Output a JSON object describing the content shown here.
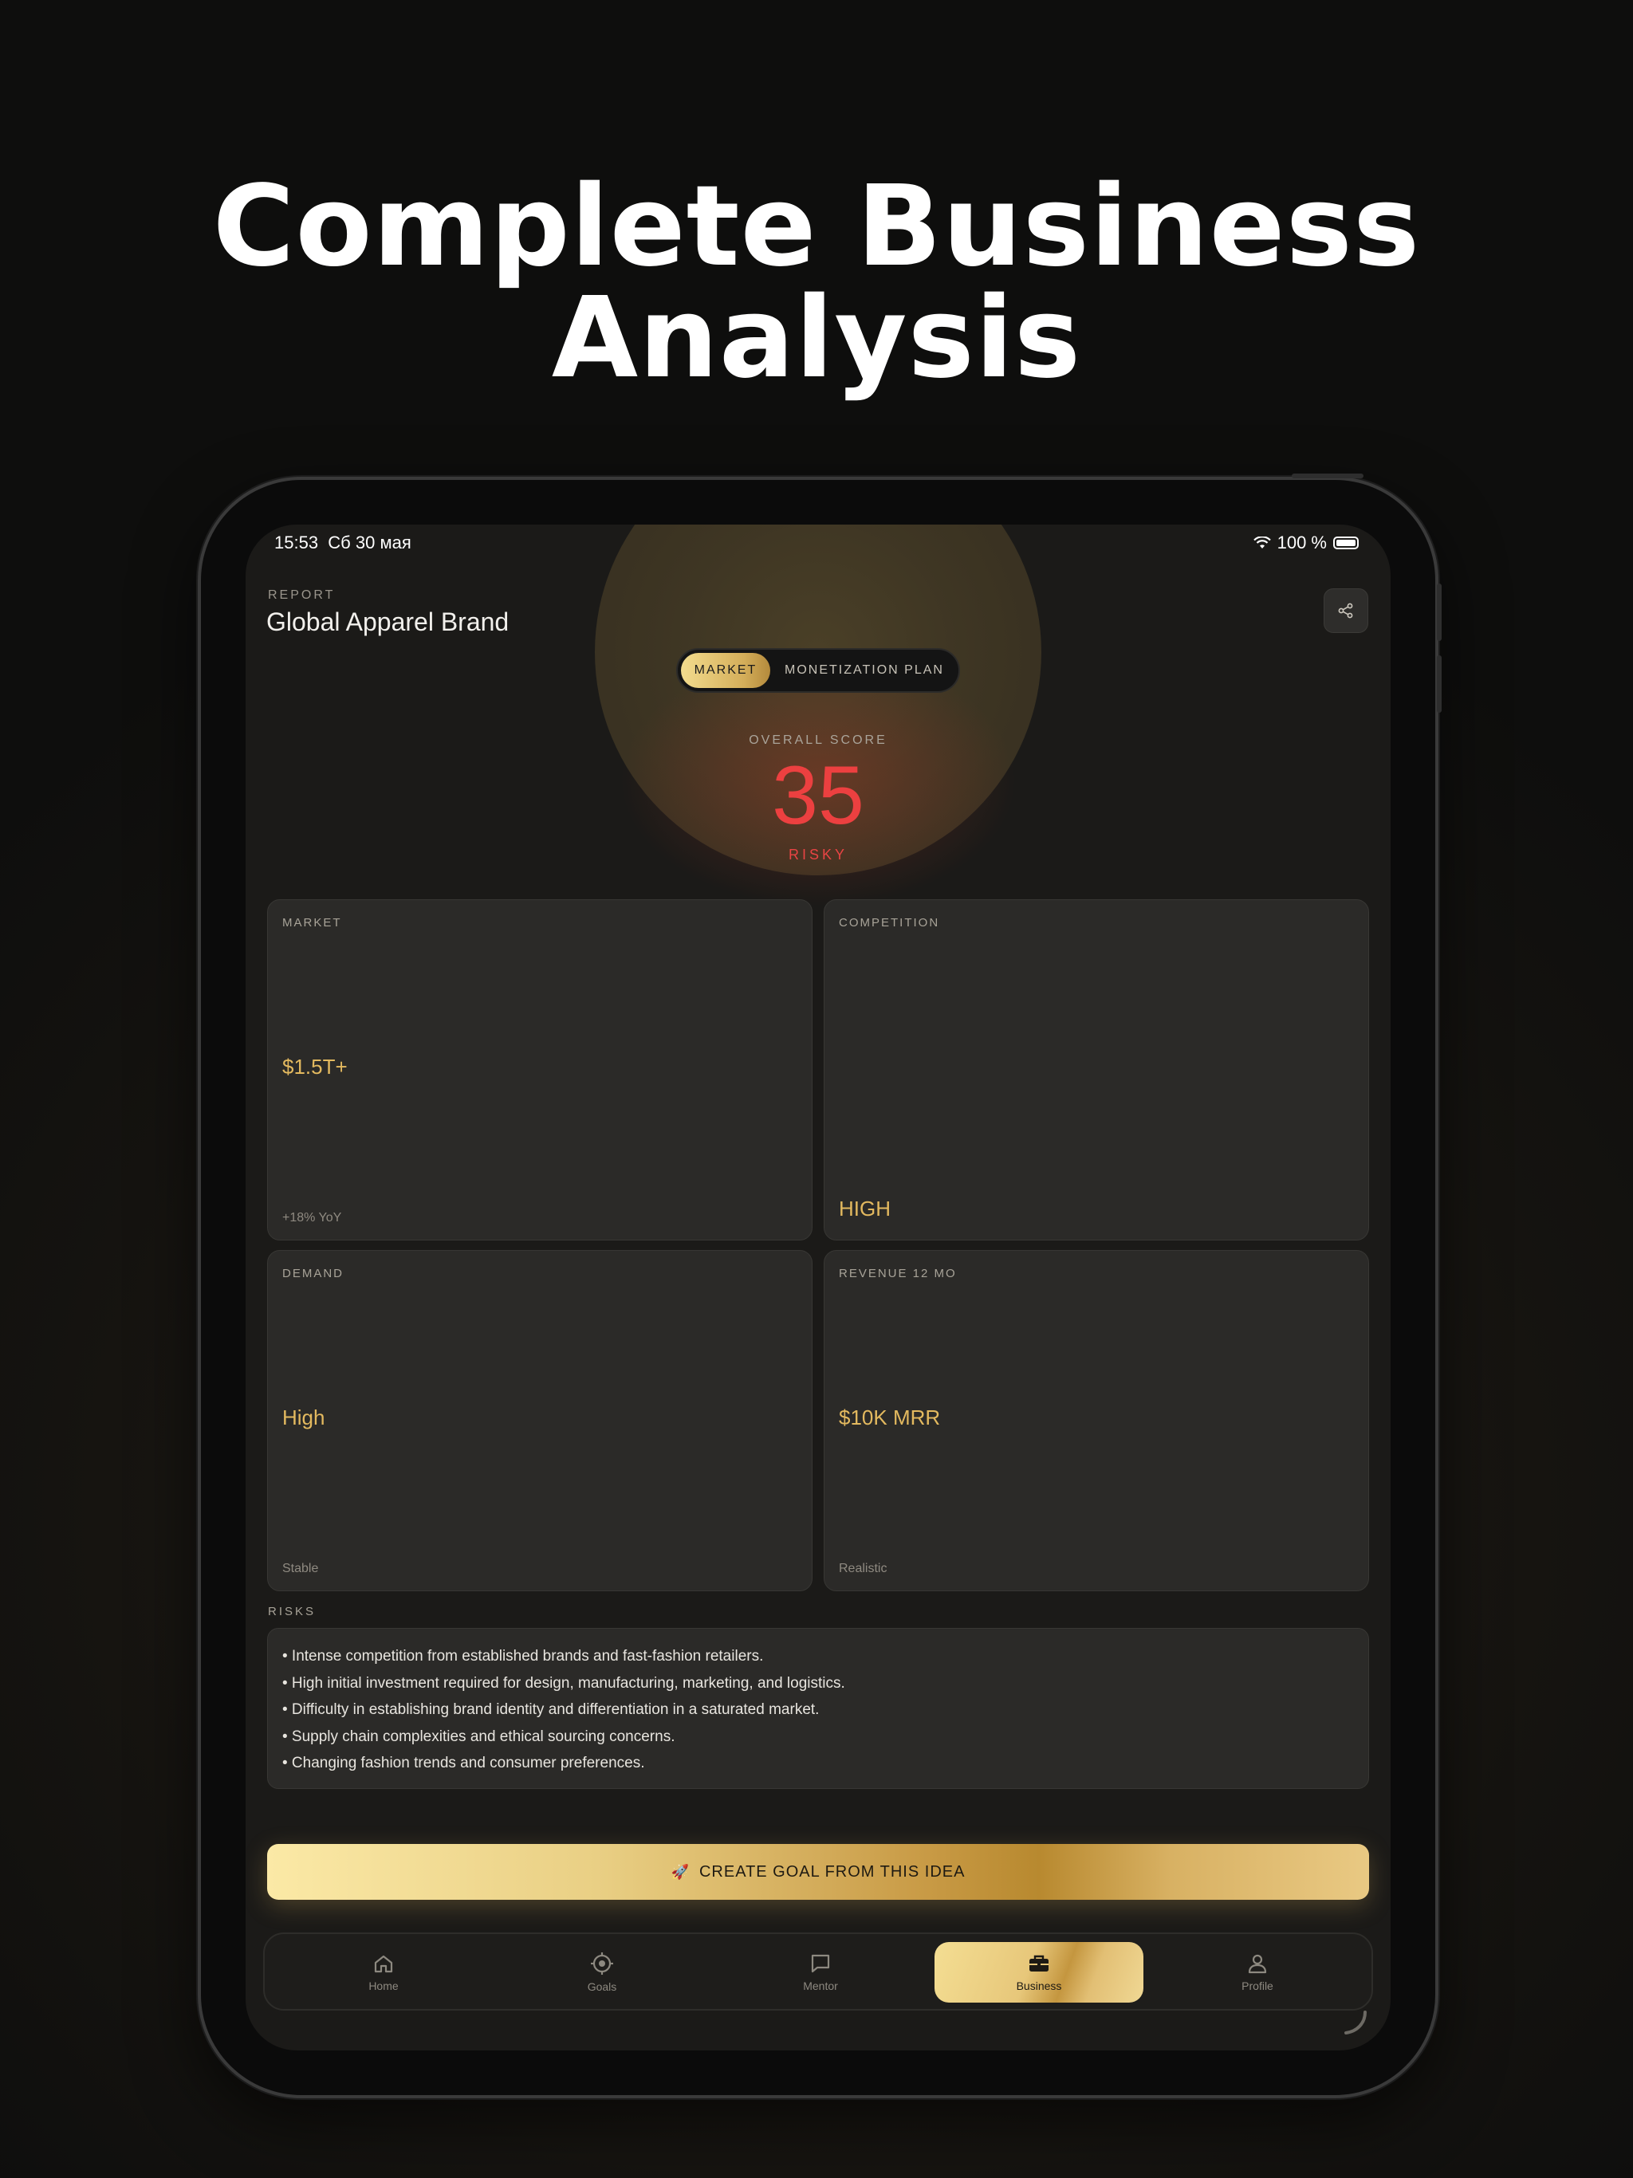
{
  "headline": {
    "line1": "Complete Business",
    "line2": "Analysis"
  },
  "status_bar": {
    "time": "15:53",
    "date": "Сб 30 мая",
    "battery": "100 %"
  },
  "header": {
    "label": "REPORT",
    "title": "Global Apparel Brand",
    "share_icon": "share-icon"
  },
  "segment": {
    "active": "MARKET",
    "inactive": "MONETIZATION PLAN"
  },
  "score": {
    "label": "OVERALL SCORE",
    "value": "35",
    "status": "RISKY",
    "color": "#ec4040"
  },
  "cards": [
    {
      "label": "MARKET",
      "value": "$1.5T+",
      "sub": "+18% YoY"
    },
    {
      "label": "COMPETITION",
      "value": "HIGH",
      "sub": ""
    },
    {
      "label": "DEMAND",
      "value": "High",
      "sub": "Stable"
    },
    {
      "label": "REVENUE 12 MO",
      "value": "$10K MRR",
      "sub": "Realistic"
    }
  ],
  "risks": {
    "label": "RISKS",
    "items": [
      "• Intense competition from established brands and fast-fashion retailers.",
      "• High initial investment required for design, manufacturing, marketing, and logistics.",
      "• Difficulty in establishing brand identity and differentiation in a saturated market.",
      "• Supply chain complexities and ethical sourcing concerns.",
      "• Changing fashion trends and consumer preferences."
    ]
  },
  "cta": {
    "icon": "🚀",
    "label": "CREATE GOAL FROM THIS IDEA"
  },
  "tabs": [
    {
      "label": "Home",
      "icon": "home-icon"
    },
    {
      "label": "Goals",
      "icon": "target-icon"
    },
    {
      "label": "Mentor",
      "icon": "chat-icon"
    },
    {
      "label": "Business",
      "icon": "briefcase-icon"
    },
    {
      "label": "Profile",
      "icon": "user-icon"
    }
  ],
  "colors": {
    "accent_gold": "#e3b95f",
    "danger": "#ec4040",
    "background": "#1b1a18"
  }
}
